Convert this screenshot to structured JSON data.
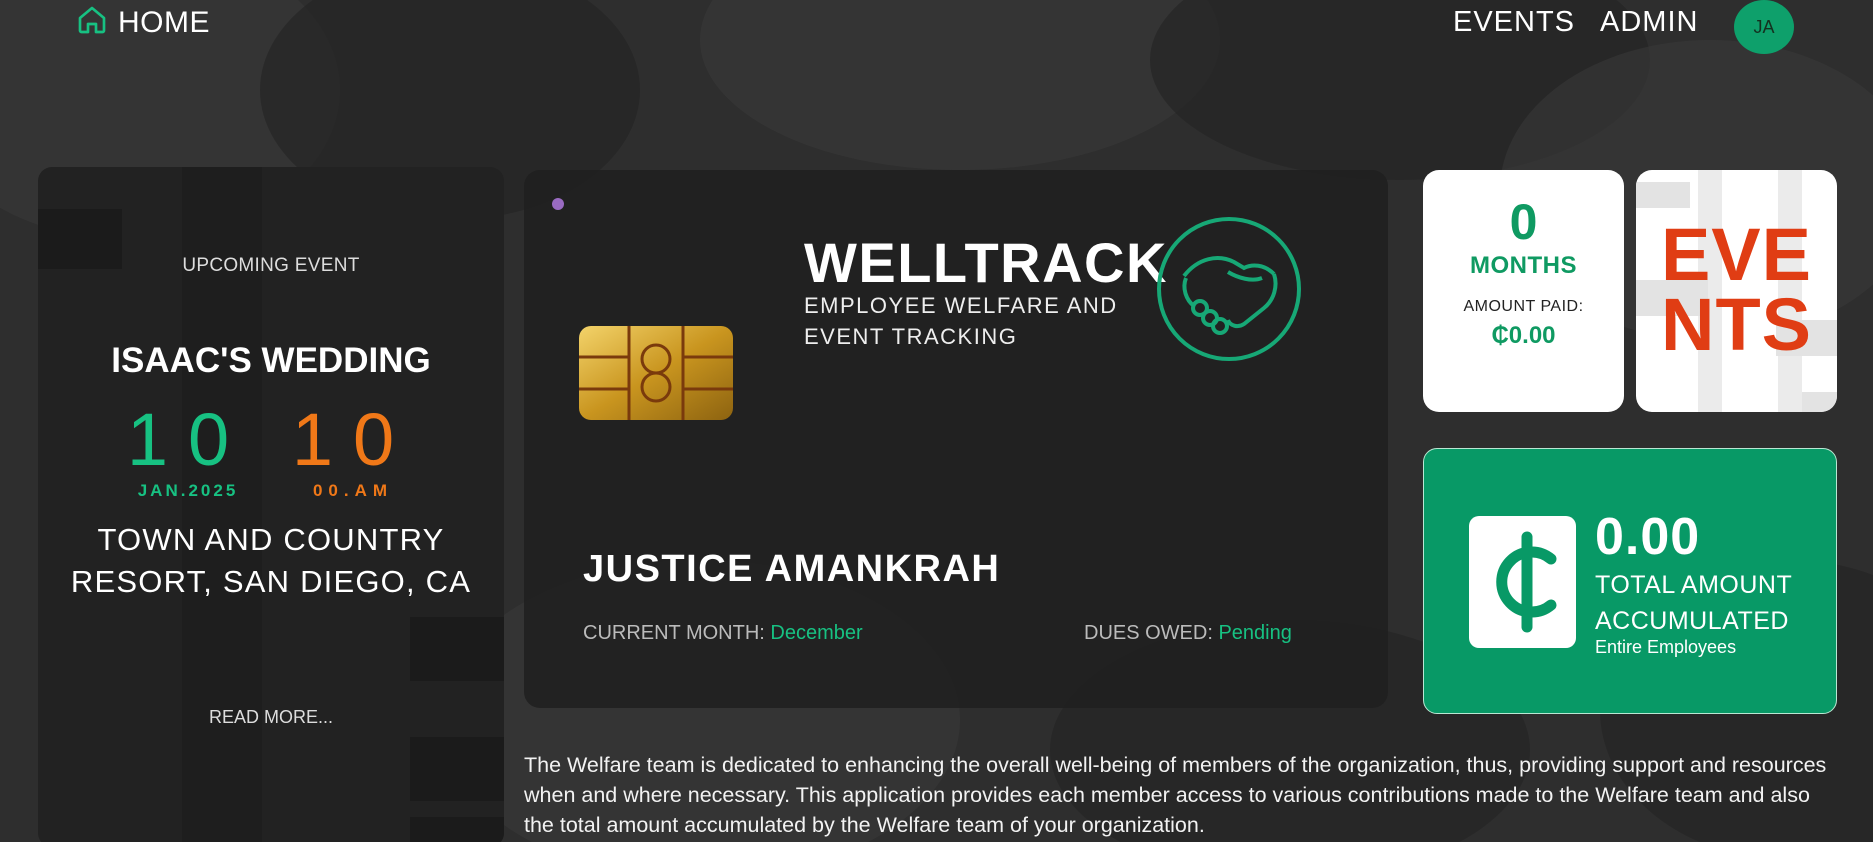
{
  "nav": {
    "home_label": "HOME",
    "events_label": "EVENTS",
    "admin_label": "ADMIN",
    "avatar_initials": "JA"
  },
  "upcoming": {
    "section_label": "UPCOMING EVENT",
    "event_name": "ISAAC'S WEDDING",
    "date_day": "10",
    "date_sub": "JAN.2025",
    "time_hour": "10",
    "time_sub": "00.AM",
    "venue": "TOWN AND COUNTRY RESORT, SAN DIEGO, CA",
    "read_more": "READ MORE..."
  },
  "card": {
    "brand": "WELLTRACK",
    "tagline": "EMPLOYEE WELFARE AND EVENT TRACKING",
    "holder_name": "JUSTICE AMANKRAH",
    "current_month_label": "CURRENT MONTH:",
    "current_month_value": "December",
    "dues_label": "DUES OWED:",
    "dues_value": "Pending"
  },
  "months_tile": {
    "count": "0",
    "unit": "MONTHS",
    "amount_label": "AMOUNT PAID:",
    "amount_value": "₵0.00"
  },
  "events_tile": {
    "line1": "EVE",
    "line2": "NTS"
  },
  "total": {
    "value": "0.00",
    "label": "TOTAL AMOUNT ACCUMULATED",
    "sub": "Entire Employees"
  },
  "description": "The Welfare team is dedicated to enhancing the overall well-being of members of the organization, thus, providing support and resources when and where necessary. This application provides each member access to various contributions made to the Welfare team and also the total amount accumulated by the Welfare team of your organization.",
  "colors": {
    "accent_green": "#17c182",
    "brand_green": "#089966",
    "time_orange": "#f07818",
    "events_red": "#e03d14"
  },
  "icons": {
    "home": "home-icon",
    "chip": "card-chip-icon",
    "logo": "handshake-logo-icon",
    "currency": "cedi-icon"
  }
}
